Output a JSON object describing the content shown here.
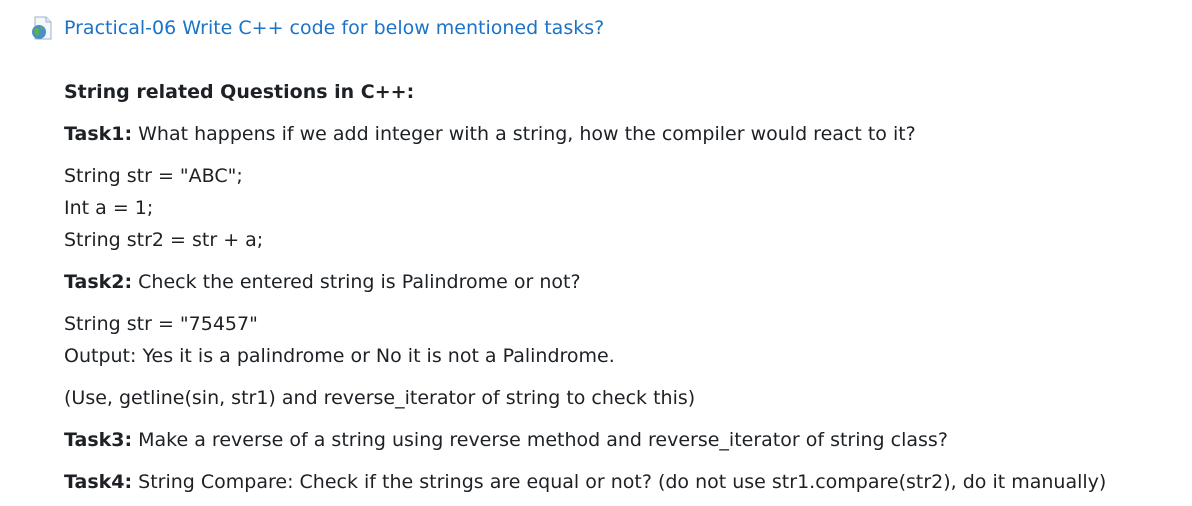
{
  "activity": {
    "icon": "assignment-globe-icon",
    "title": "Practical-06 Write C++ code for below mentioned tasks?"
  },
  "content": {
    "heading": "String related Questions in C++:",
    "task1": {
      "label": "Task1:",
      "text": " What happens if we add integer with a string, how the compiler would react to it?",
      "code": [
        "String str = \"ABC\";",
        "Int a = 1;",
        "String str2 = str + a;"
      ]
    },
    "task2": {
      "label": "Task2:",
      "text": " Check the entered string is Palindrome or not?",
      "lines": [
        "String str = \"75457\"",
        "Output: Yes it is a palindrome or No it is not a Palindrome."
      ],
      "hint": "(Use, getline(sin, str1) and reverse_iterator of string to check this)"
    },
    "task3": {
      "label": "Task3:",
      "text": " Make a reverse of a string using reverse method and reverse_iterator of string class?"
    },
    "task4": {
      "label": "Task4:",
      "text": " String Compare: Check if the strings are equal or not? (do not use str1.compare(str2), do it manually)"
    }
  }
}
